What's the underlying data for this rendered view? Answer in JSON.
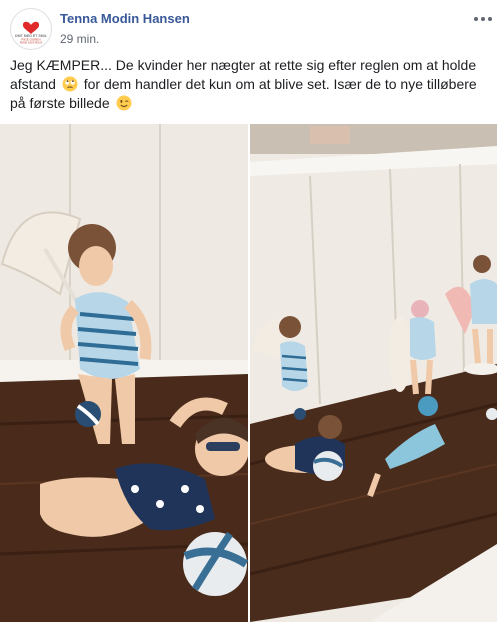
{
  "post": {
    "author": "Tenna Modin Hansen",
    "timestamp": "29 min.",
    "text_part1": "Jeg KÆMPER... De kvinder her nægter at rette sig efter reglen om at holde afstand",
    "text_part2": "for dem handler det kun om at blive set. Især de to nye tilløbere på første billede",
    "emoji_1": "rolling-eyes-emoji",
    "emoji_2": "winking-face-emoji"
  },
  "avatar": {
    "heart_icon": "heart-icon",
    "logo_line1": "DMT MED ET SMIL",
    "logo_line2": "RIGE OGREN",
    "logo_line3": "RIGE SOSTEUS"
  },
  "photos": [
    {
      "description_icon": "figurines-closeup-photo"
    },
    {
      "description_icon": "figurines-shelf-photo"
    }
  ],
  "colors": {
    "author_link": "#385898",
    "meta": "#606770",
    "text": "#1c1e21",
    "shelf_wood": "#4a2c1c",
    "wall": "#f2eee8"
  }
}
